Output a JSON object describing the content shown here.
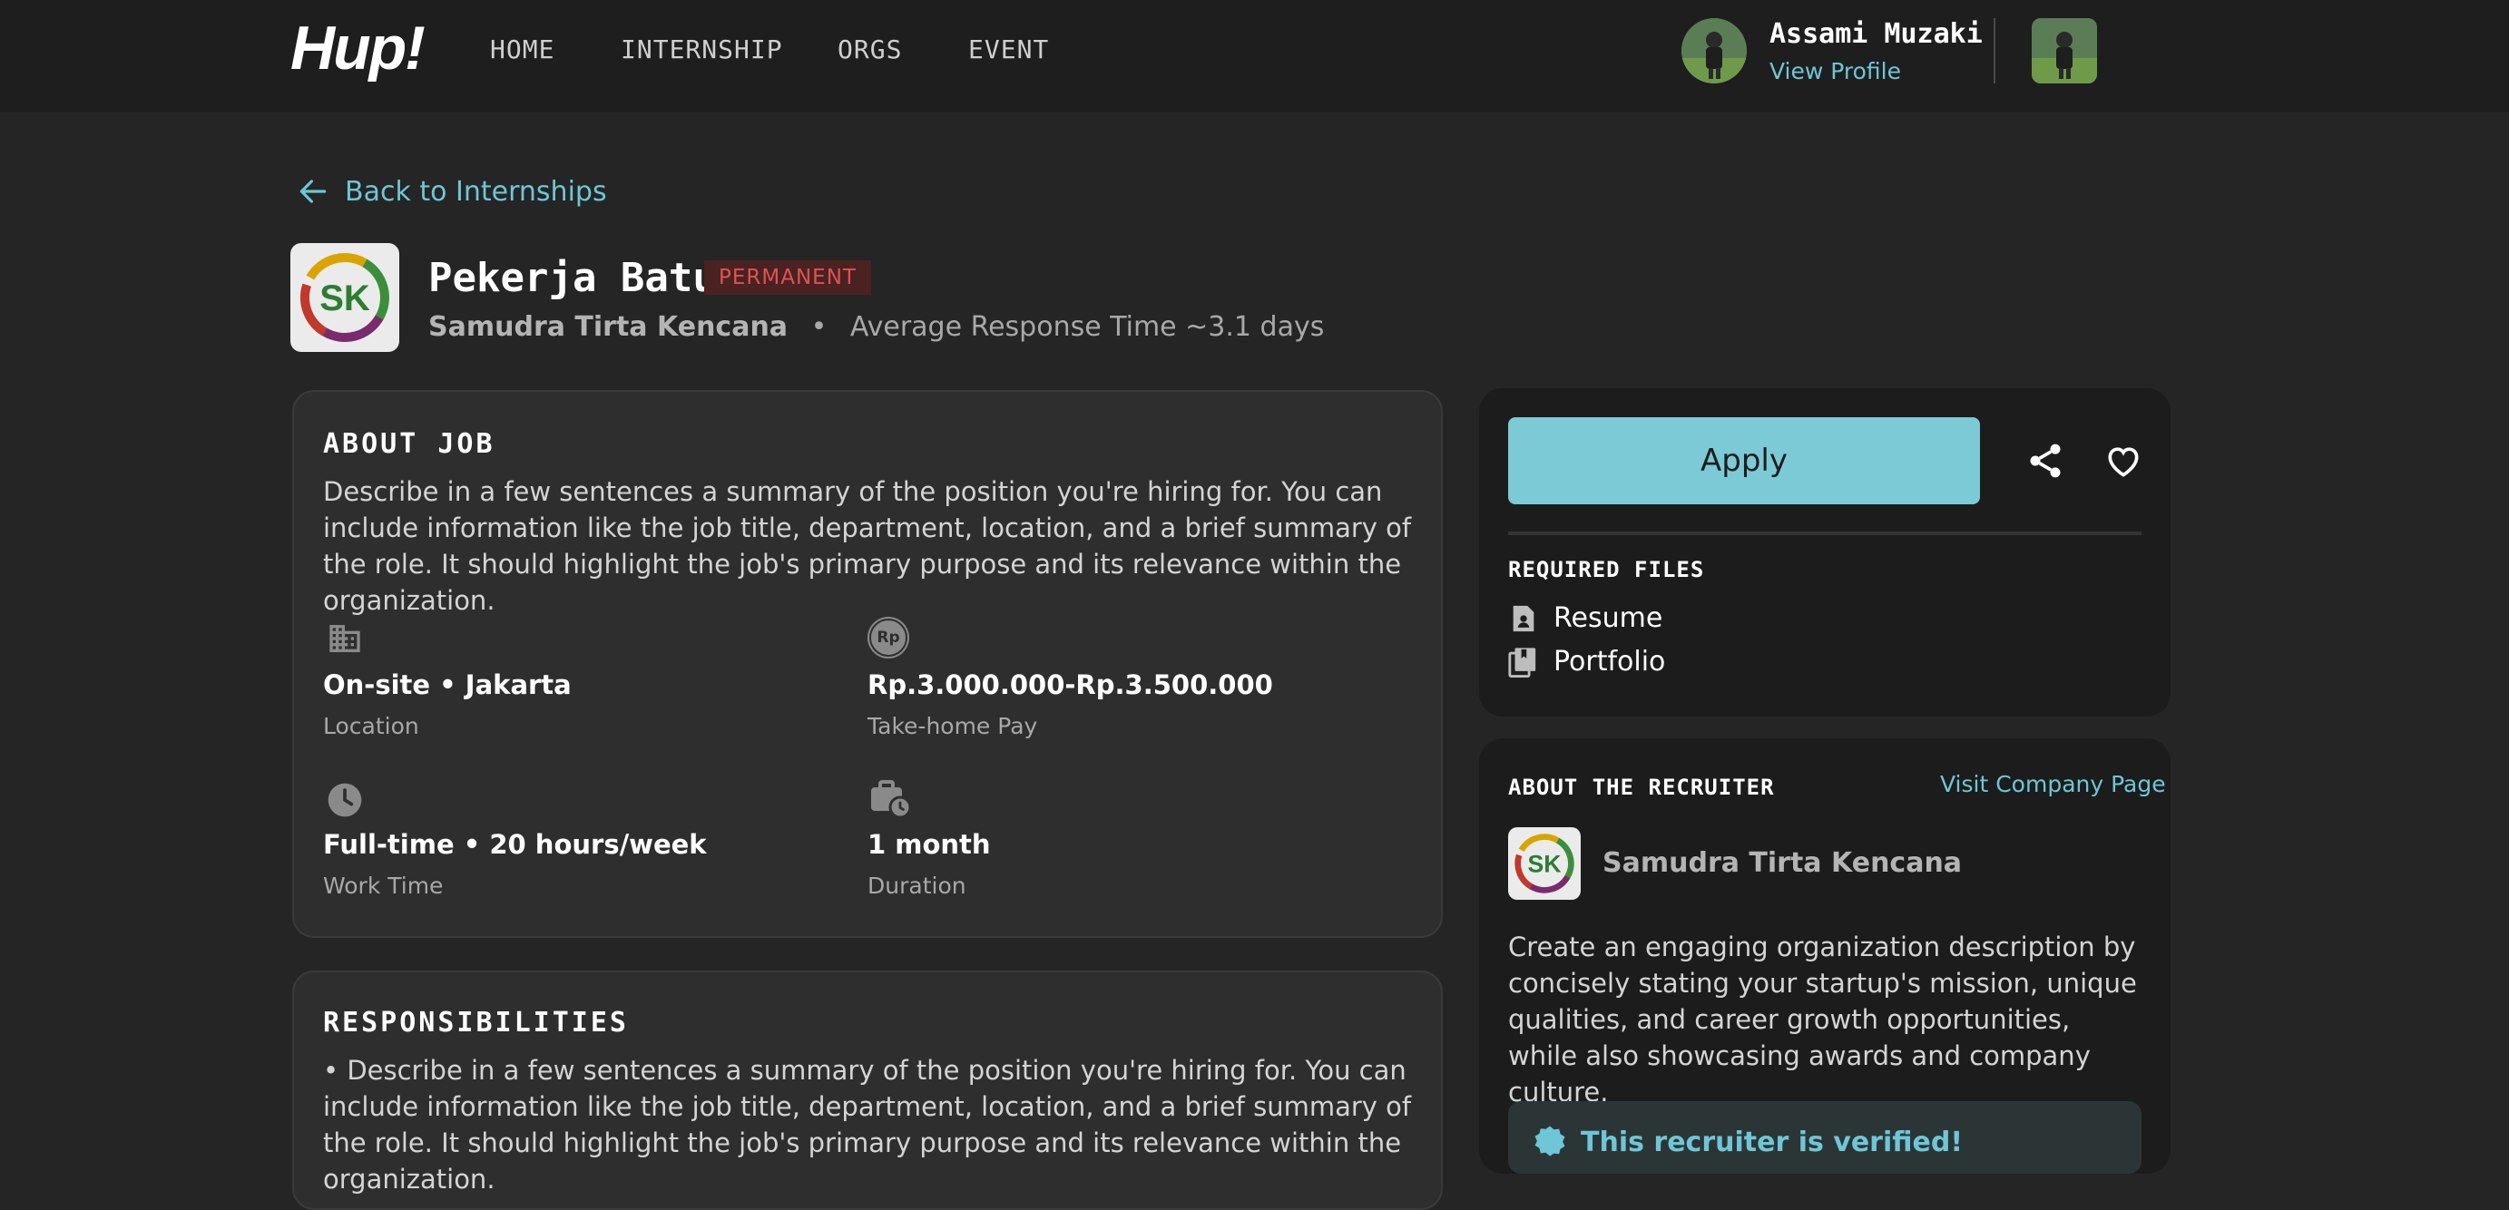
{
  "nav": {
    "logo": "Hup!",
    "links": [
      "HOME",
      "INTERNSHIP",
      "ORGS",
      "EVENT"
    ],
    "user_name": "Assami Muzaki",
    "view_profile": "View Profile"
  },
  "back_link": "Back to Internships",
  "job": {
    "title": "Pekerja Batu",
    "badge": "PERMANENT",
    "company": "Samudra Tirta Kencana",
    "separator": "•",
    "response_time": "Average Response Time ~3.1 days",
    "logo_text": "SK"
  },
  "about_job": {
    "heading": "ABOUT JOB",
    "description": "Describe in a few sentences a summary of the position you're hiring for. You can include information like the job title, department, location, and a brief summary of the role. It should highlight the job's primary purpose and its relevance within the organization.",
    "info": [
      {
        "value": "On-site • Jakarta",
        "label": "Location",
        "icon": "building-icon"
      },
      {
        "value": "Rp.3.000.000-Rp.3.500.000",
        "label": "Take-home Pay",
        "icon": "rupiah-icon"
      },
      {
        "value": "Full-time • 20 hours/week",
        "label": "Work Time",
        "icon": "clock-icon"
      },
      {
        "value": "1 month",
        "label": "Duration",
        "icon": "briefcase-clock-icon"
      }
    ],
    "rupiah_glyph": "Rp"
  },
  "responsibilities": {
    "heading": "RESPONSIBILITIES",
    "text": "• Describe in a few sentences a summary of the position you're hiring for. You can include information like the job title, department, location, and a brief summary of the role. It should highlight the job's primary purpose and its relevance within the organization."
  },
  "apply": {
    "button": "Apply",
    "required_files_heading": "REQUIRED FILES",
    "files": [
      "Resume",
      "Portfolio"
    ]
  },
  "recruiter": {
    "heading": "ABOUT THE RECRUITER",
    "visit_link": "Visit Company Page",
    "name": "Samudra Tirta Kencana",
    "description": "Create an engaging organization description by concisely stating your startup's mission, unique qualities, and career growth opportunities, while also showcasing awards and company culture.",
    "verified_text": "This recruiter is verified!"
  },
  "colors": {
    "accent": "#6ec6d6",
    "apply_button": "#7ccad6",
    "badge_text": "#e05252",
    "badge_bg": "#4a2222",
    "background": "#252525"
  }
}
